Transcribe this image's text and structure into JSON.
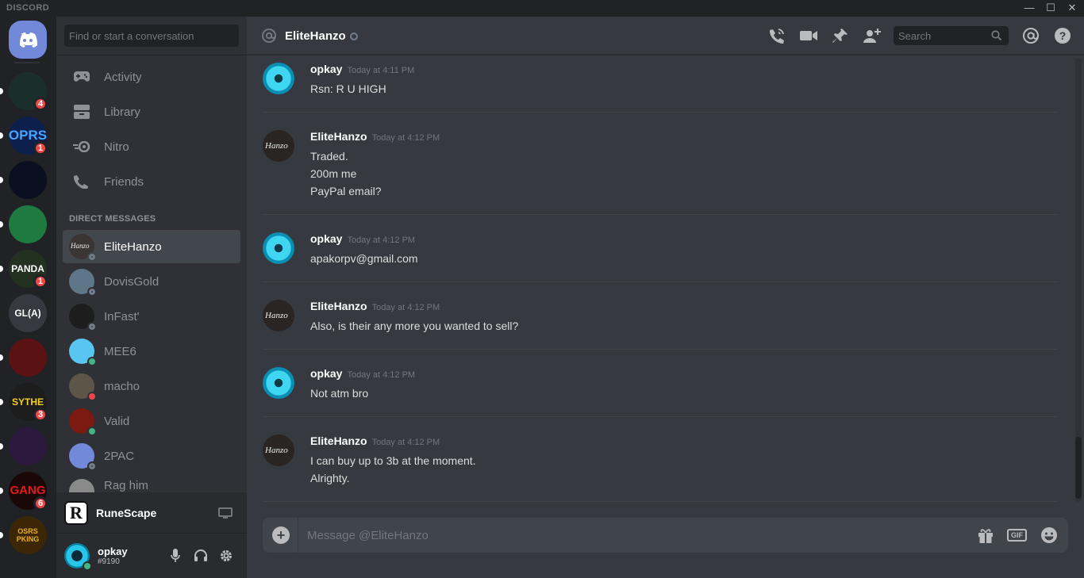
{
  "window": {
    "brand": "DISCORD",
    "minimize": "—",
    "maximize": "☐",
    "close": "✕"
  },
  "guilds": [
    {
      "label": "",
      "badge": "",
      "color": "#7289da"
    },
    {
      "label": "",
      "badge": "4",
      "color": "#1b2f2a"
    },
    {
      "label": "OPRS",
      "badge": "1",
      "color": "#0c1f4d"
    },
    {
      "label": "",
      "badge": "",
      "color": "#0b1021"
    },
    {
      "label": "",
      "badge": "",
      "color": "#1f7a3f"
    },
    {
      "label": "PANDA",
      "badge": "1",
      "color": "#233121"
    },
    {
      "label": "GL(A)",
      "badge": "",
      "color": "#36393f"
    },
    {
      "label": "",
      "badge": "",
      "color": "#5a1212"
    },
    {
      "label": "SYTHE",
      "badge": "3",
      "color": "#1d1d1d"
    },
    {
      "label": "",
      "badge": "",
      "color": "#2b1a3d"
    },
    {
      "label": "GANG",
      "badge": "6",
      "color": "#1a0707"
    },
    {
      "label": "OSRS PKING",
      "badge": "",
      "color": "#3b2606"
    }
  ],
  "sidebar": {
    "search_placeholder": "Find or start a conversation",
    "nav": [
      {
        "label": "Activity",
        "icon": "gamepad-icon"
      },
      {
        "label": "Library",
        "icon": "library-icon"
      },
      {
        "label": "Nitro",
        "icon": "nitro-icon"
      },
      {
        "label": "Friends",
        "icon": "friends-icon"
      }
    ],
    "dm_header": "DIRECT MESSAGES",
    "dms": [
      {
        "name": "EliteHanzo",
        "status": "offline",
        "color": "#3a3434",
        "avatar_text": "Hanzo"
      },
      {
        "name": "DovisGold",
        "status": "offline",
        "color": "#5f7588",
        "avatar_text": ""
      },
      {
        "name": "InFast'",
        "status": "offline",
        "color": "#1d1d1d",
        "avatar_text": ""
      },
      {
        "name": "MEE6",
        "status": "online",
        "color": "#58c6f0",
        "avatar_text": ""
      },
      {
        "name": "macho",
        "status": "dnd",
        "color": "#5d5648",
        "avatar_text": ""
      },
      {
        "name": "Valid",
        "status": "online",
        "color": "#7a1a10",
        "avatar_text": ""
      },
      {
        "name": "2PAC",
        "status": "offline",
        "color": "#7289da",
        "avatar_text": ""
      },
      {
        "name": "Rag him",
        "status": "offline",
        "color": "#8a8a8a",
        "avatar_text": ""
      }
    ],
    "app": {
      "name": "RuneScape",
      "logo": "R"
    },
    "user": {
      "name": "opkay",
      "tag": "#9190"
    }
  },
  "chat": {
    "recipient": "EliteHanzo",
    "search_placeholder": "Search",
    "composer_placeholder": "Message @EliteHanzo",
    "gif_label": "GIF",
    "messages": [
      {
        "author": "opkay",
        "time": "Today at 4:11 PM",
        "lines": [
          "Rsn: R U HIGH"
        ],
        "avatar": "opkay"
      },
      {
        "author": "EliteHanzo",
        "time": "Today at 4:12 PM",
        "lines": [
          "Traded.",
          "200m me",
          "PayPal email?"
        ],
        "avatar": "Hanzo"
      },
      {
        "author": "opkay",
        "time": "Today at 4:12 PM",
        "lines": [
          "apakorpv@gmail.com"
        ],
        "avatar": "opkay"
      },
      {
        "author": "EliteHanzo",
        "time": "Today at 4:12 PM",
        "lines": [
          "Also, is their any more you wanted to sell?"
        ],
        "avatar": "Hanzo"
      },
      {
        "author": "opkay",
        "time": "Today at 4:12 PM",
        "lines": [
          "Not atm bro"
        ],
        "avatar": "opkay"
      },
      {
        "author": "EliteHanzo",
        "time": "Today at 4:12 PM",
        "lines": [
          "I can buy up to 3b at the moment.",
          "Alrighty."
        ],
        "avatar": "Hanzo"
      }
    ]
  },
  "colors": {
    "online": "#43b581",
    "dnd": "#f04747",
    "offline": "#747f8d",
    "accent": "#7289da"
  }
}
